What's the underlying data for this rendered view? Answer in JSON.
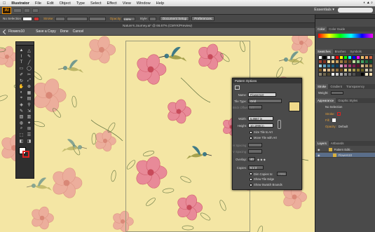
{
  "menubar": {
    "app": "Illustrator",
    "items": [
      "File",
      "Edit",
      "Object",
      "Type",
      "Select",
      "Effect",
      "View",
      "Window",
      "Help"
    ]
  },
  "appbar": {
    "logo": "Ai",
    "workspace": "Essentials ▾"
  },
  "control": {
    "no_selection": "No Selection",
    "stroke_label": "Stroke:",
    "opacity_label": "Opacity:",
    "opacity_value": "100%",
    "style_label": "Style:",
    "document_setup": "Document Setup",
    "preferences": "Preferences"
  },
  "document": {
    "title": "Nature's Journey.ai* @ 66.67% (CMYK/Preview)"
  },
  "isolation": {
    "object": "Flowers10",
    "save_copy": "Save a Copy",
    "done": "Done",
    "cancel": "Cancel"
  },
  "pattern_options": {
    "title": "Pattern Options",
    "name_label": "Name:",
    "name_value": "Flowers10",
    "tile_type_label": "Tile Type:",
    "tile_type_value": "Grid",
    "brick_offset_label": "Brick Offset:",
    "brick_offset_value": "1/2",
    "width_label": "Width:",
    "width_value": "5.8667 in",
    "height_label": "Height:",
    "height_value": "10.1996 in",
    "size_tile_to_art": "Size Tile to Art",
    "move_tile_with_art": "Move Tile with Art",
    "h_spacing_label": "H Spacing:",
    "v_spacing_label": "V Spacing:",
    "overlap_label": "Overlap:",
    "overlap_value": "40",
    "copies_label": "Copies:",
    "copies_value": "5 x 3",
    "dim_copies_to": "Dim Copies to:",
    "dim_value": "70%",
    "show_tile_edge": "Show Tile Edge",
    "show_swatch_bounds": "Show Swatch Bounds"
  },
  "right_panel": {
    "color_tabs": [
      "Color",
      "Color Guide"
    ],
    "swatch_tabs": [
      "Swatches",
      "Brushes",
      "Symbols"
    ],
    "stroke_tabs": [
      "Stroke",
      "Gradient",
      "Transparency"
    ],
    "weight_label": "Weight:",
    "appearance_tabs": [
      "Appearance",
      "Graphic Styles"
    ],
    "appearance_no_selection": "No Selection",
    "appearance_stroke": "Stroke:",
    "appearance_fill": "Fill:",
    "appearance_opacity": "Opacity:",
    "appearance_opacity_value": "Default",
    "layers_tabs": [
      "Layers",
      "Artboards"
    ],
    "layer_rows": [
      "Pattern Editi...",
      "Flowers10"
    ]
  },
  "colors": {
    "canvas": "#f4e6a4",
    "flower": "#e88a98",
    "flower_center": "#c84a5a",
    "hummingbird_head": "#3f7a86",
    "hummingbird_body": "#a6a24e",
    "leaf": "#8a9a48",
    "leaf_outline": "#5a6d3c"
  },
  "swatch_colors": [
    "#ffffff",
    "#000000",
    "#e8e8e8",
    "#c8c8c8",
    "#ff0000",
    "#ffff00",
    "#00ff00",
    "#00ffff",
    "#0000ff",
    "#ff00ff",
    "#e8c070",
    "#f0a060",
    "#d06040",
    "#a04030",
    "#803020",
    "#f8e0a0",
    "#e0c080",
    "#c8a060",
    "#a08040",
    "#806030",
    "#604020",
    "#c0e0a0",
    "#80c080",
    "#40a060",
    "#207040",
    "#105030",
    "#a0d0e0",
    "#60a0c0",
    "#4080a0",
    "#206080",
    "#104060",
    "#e0a0c0",
    "#c06090",
    "#a04070",
    "#802050",
    "#601030",
    "#d8b888",
    "#b89868",
    "#987848",
    "#785828",
    "#f0d0a0",
    "#d0b080",
    "#b09060",
    "#907040",
    "#705020",
    "#e8d890",
    "#c8b870",
    "#a89850",
    "#887830",
    "#686020",
    "#d0c8b0",
    "#b0a890",
    "#908870",
    "#706850",
    "#504830",
    "#f0f0f0",
    "#d0d0d0",
    "#b0b0b0",
    "#909090",
    "#707070",
    "#505050",
    "#303030",
    "#000000",
    "#fff0d0",
    "#ffe0b0"
  ]
}
